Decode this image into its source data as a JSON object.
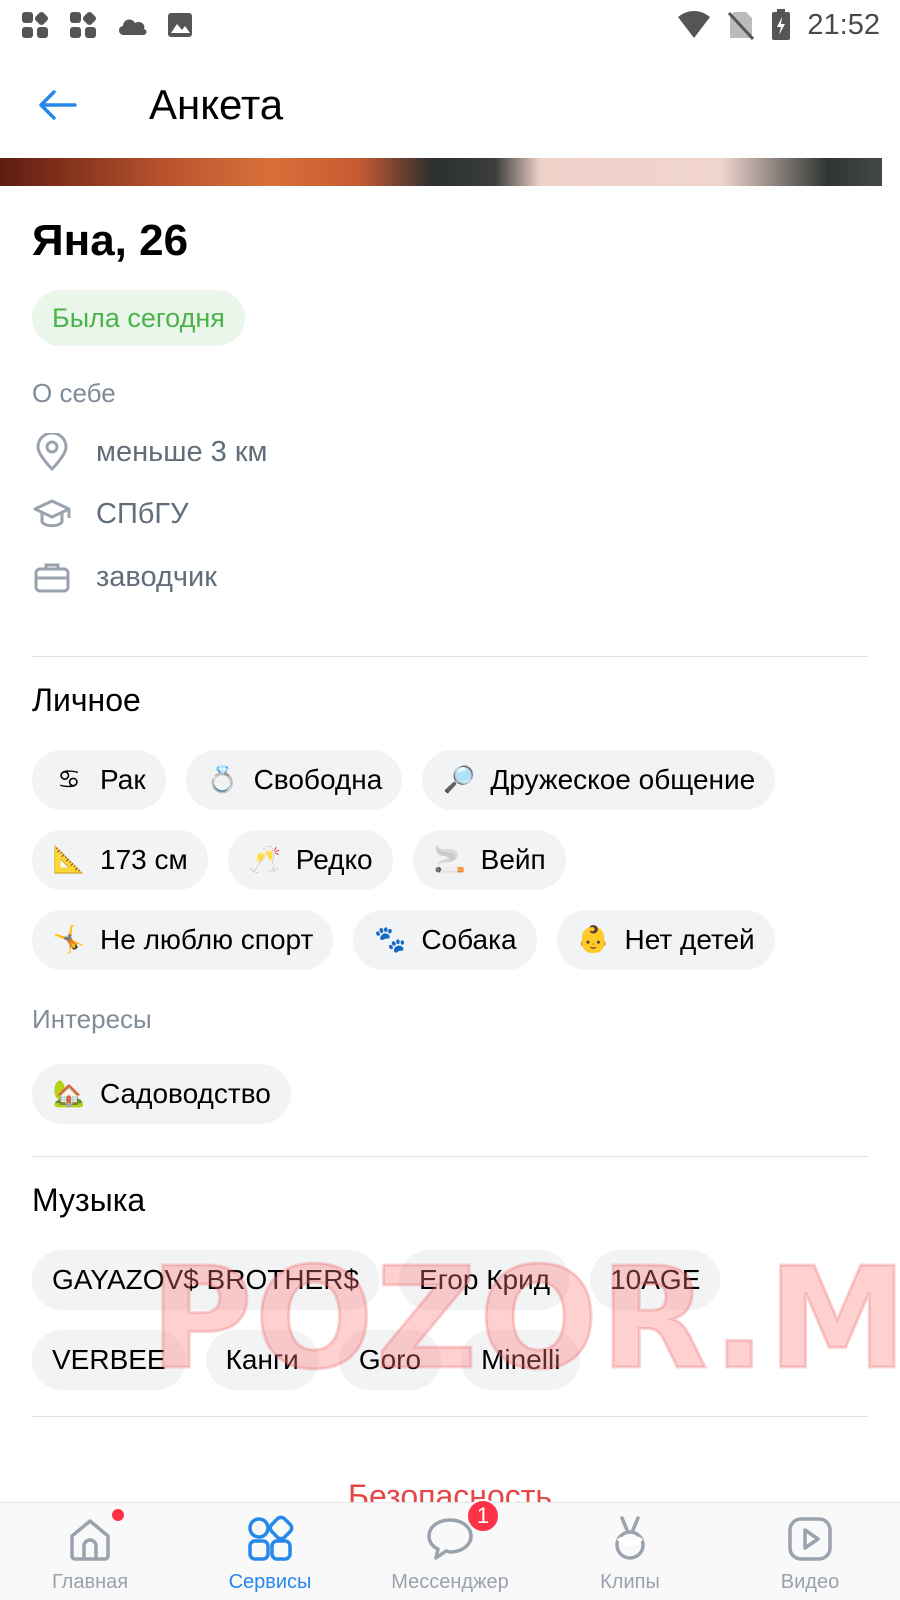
{
  "status_bar": {
    "time": "21:52",
    "left_icons": [
      "app-grid-icon",
      "app-grid-icon",
      "cloud-icon",
      "image-icon"
    ],
    "right_icons": [
      "wifi-icon",
      "no-sim-icon",
      "battery-icon"
    ]
  },
  "header": {
    "back_icon": "arrow-left-icon",
    "title": "Анкета"
  },
  "profile": {
    "name": "Яна, 26",
    "online_status": "Была сегодня",
    "about_label": "О себе",
    "info": [
      {
        "icon": "location-pin-icon",
        "text": "меньше 3 км"
      },
      {
        "icon": "graduation-cap-icon",
        "text": "СПбГУ"
      },
      {
        "icon": "briefcase-icon",
        "text": "заводчик"
      }
    ]
  },
  "personal": {
    "title": "Личное",
    "chips": [
      {
        "icon": "cancer-zodiac-icon",
        "glyph": "♋",
        "label": "Рак"
      },
      {
        "icon": "ring-icon",
        "glyph": "💍",
        "label": "Свободна"
      },
      {
        "icon": "magnifier-icon",
        "glyph": "🔎",
        "label": "Дружеское общение"
      },
      {
        "icon": "triangle-ruler-icon",
        "glyph": "📐",
        "label": "173 см"
      },
      {
        "icon": "champagne-glasses-icon",
        "glyph": "🥂",
        "label": "Редко"
      },
      {
        "icon": "cigarette-icon",
        "glyph": "🚬",
        "label": "Вейп"
      },
      {
        "icon": "cartwheel-person-icon",
        "glyph": "🤸",
        "label": "Не люблю спорт"
      },
      {
        "icon": "paw-prints-icon",
        "glyph": "🐾",
        "label": "Собака"
      },
      {
        "icon": "baby-icon",
        "glyph": "👶",
        "label": "Нет детей"
      }
    ],
    "interests_label": "Интересы",
    "interests": [
      {
        "icon": "house-garden-icon",
        "glyph": "🏡",
        "label": "Садоводство"
      }
    ]
  },
  "music": {
    "title": "Музыка",
    "artists": [
      "GAYAZOV$ BROTHER$",
      "Егор Крид",
      "10AGE",
      "VERBEE",
      "Канги",
      "Goro",
      "Minelli"
    ]
  },
  "safety_label": "Безопасность",
  "watermark": "POZOR.ME",
  "tabbar": {
    "tabs": [
      {
        "icon": "home-icon",
        "label": "Главная",
        "active": false,
        "dot": true
      },
      {
        "icon": "services-grid-icon",
        "label": "Сервисы",
        "active": true
      },
      {
        "icon": "messenger-bubble-icon",
        "label": "Мессенджер",
        "active": false,
        "badge": "1"
      },
      {
        "icon": "clips-icon",
        "label": "Клипы",
        "active": false
      },
      {
        "icon": "video-icon",
        "label": "Видео",
        "active": false
      }
    ]
  },
  "colors": {
    "accent": "#2688eb",
    "online_green": "#4bb34b",
    "online_bg": "#ebf6ea",
    "danger": "#e64646",
    "chip_bg": "#f2f3f5",
    "secondary_text": "#818c99"
  }
}
